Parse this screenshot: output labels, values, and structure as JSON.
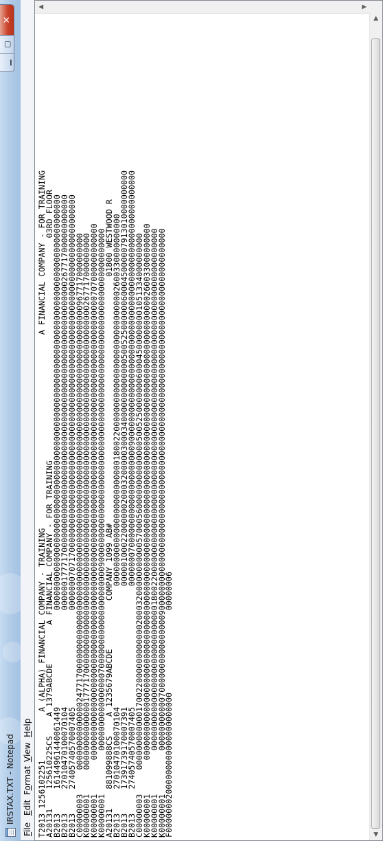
{
  "window": {
    "title": "IRSTAX.TXT - Notepad",
    "app_icon": "notepad-icon"
  },
  "caption_buttons": {
    "minimize": "▁",
    "maximize": "▢",
    "close": "✕"
  },
  "menu": {
    "file": {
      "mnemonic": "F",
      "rest": "ile"
    },
    "edit": {
      "mnemonic": "E",
      "rest": "dit"
    },
    "format": {
      "pre": "F",
      "mnemonic": "o",
      "rest": "rmat"
    },
    "view": {
      "mnemonic": "V",
      "rest": "iew"
    },
    "help": {
      "mnemonic": "H",
      "rest": "elp"
    }
  },
  "editor": {
    "lines": [
      "T2013 1256102251          A (ALPHA) FINANCIAL COMPANY - TRAINING                                        A FINANCIAL COMPANY - FOR TRAINING",
      "A20131    125610225CS    A 1379ABCDE        A FINANCIAL COMPANY - FOR TRAINING                                              03RD FLOOR",
      "B2013     16144961440061449                    00000000000000000000000000000000000000000000000000000000000000000000000000000000000000",
      "B2013     27010470100070104                    00000017771700000000000000000000000000000000000000000000000000000000267717000000000000",
      "B2013     27405740570007405                    00000007071700000000000000000000000000000000000000000000000000000000000000000000000000",
      "C00000003     000000000000002477170000000000000000000000000000000000000000000000000000000000000000000000000000967717000000000",
      "K00000001     000000000000001777170000000000000000000000000000000000000000000000000000000000000000000000000000267717000000000",
      "K00000001       000000000000000000000000000000000000000000000000000000000000000000000000000000000000000000000000707000000000000",
      "K00000001         000000000000000070000000000000000000009000000000000000000000000000000000000000000000000000000000000000000000",
      "A20131    881099888CS    A 1235679ABCDE          COMPANY 1099 AB#                                                   01800 WESTWOOD R",
      "B2013     27010470100070104                         00000000000000000000000000180022000000000000000000000000000002600330000000000",
      "B2013     17391739170007391                         00000100022000000200032000003000340000000000000500525000000600045000007913010000000000",
      "B2013     27405740570007405                         00000007000000000000000000000900000000000000000000000000000000000000000000000000000000",
      "C00000003     000000000000170022000000000000200032000000000005700056000000000000005005250000000600045000000001051334000000000",
      "K00000001       000000000000000000000000000000000000000000000000000000000000000000000000000000000000000000000000260033000000000",
      "K00000001         000000000000000000000000000000180022000000000000000000000000000000000000000000000000000000000000000000000000",
      "K00000001         000000000007000000000000000090000000000000000000000000000000000000000000000000000000000000000000000000000000",
      "F00000002000000000000000000000                 00000006"
    ]
  },
  "scrollbars": {
    "left_arrow": "◀",
    "right_arrow": "▶",
    "up_arrow": "▲",
    "down_arrow": "▼"
  }
}
